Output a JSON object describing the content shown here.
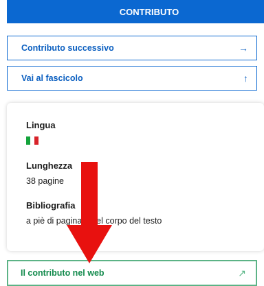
{
  "header": {
    "title": "CONTRIBUTO",
    "color": "#0b68d1"
  },
  "nav": {
    "next": {
      "label": "Contributo successivo",
      "icon": "arrow-right-icon",
      "glyph": "→"
    },
    "issue": {
      "label": "Vai al fascicolo",
      "icon": "arrow-up-icon",
      "glyph": "↑"
    }
  },
  "details": {
    "language": {
      "label": "Lingua",
      "flag": "italian-flag-icon"
    },
    "length": {
      "label": "Lunghezza",
      "value": "38 pagine"
    },
    "bibliography": {
      "label": "Bibliografia",
      "value": "a piè di pagina o nel corpo del testo"
    }
  },
  "web": {
    "label": "Il contributo nel web",
    "icon": "external-link-icon",
    "glyph": "↗",
    "color": "#128a4c"
  },
  "annotation": {
    "icon": "red-arrow-icon",
    "color": "#e8110f"
  }
}
